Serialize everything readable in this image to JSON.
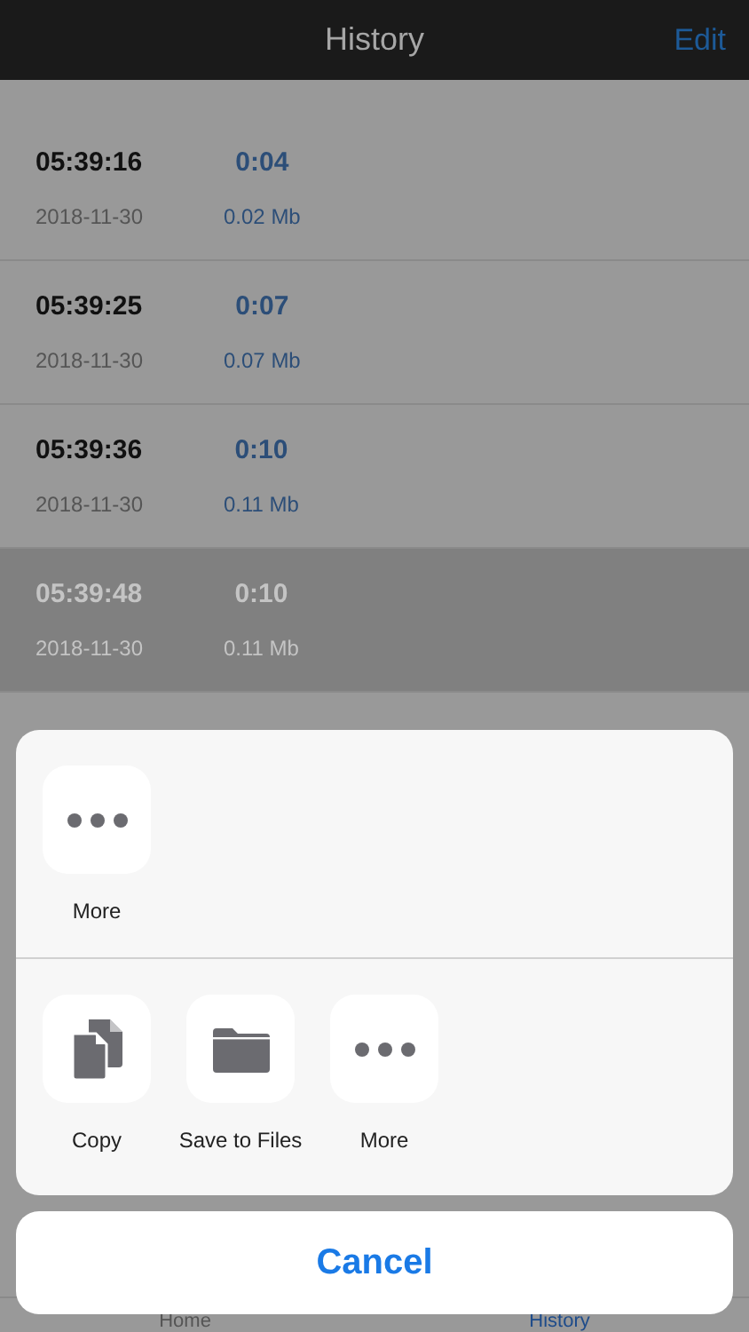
{
  "nav": {
    "title": "History",
    "edit": "Edit"
  },
  "recordings": [
    {
      "time": "05:39:16",
      "date": "2018-11-30",
      "duration": "0:04",
      "size": "0.02 Mb",
      "selected": false
    },
    {
      "time": "05:39:25",
      "date": "2018-11-30",
      "duration": "0:07",
      "size": "0.07 Mb",
      "selected": false
    },
    {
      "time": "05:39:36",
      "date": "2018-11-30",
      "duration": "0:10",
      "size": "0.11 Mb",
      "selected": false
    },
    {
      "time": "05:39:48",
      "date": "2018-11-30",
      "duration": "0:10",
      "size": "0.11 Mb",
      "selected": true
    }
  ],
  "share_sheet": {
    "apps": [
      {
        "kind": "more",
        "label": "More"
      }
    ],
    "actions": [
      {
        "kind": "copy",
        "label": "Copy"
      },
      {
        "kind": "folder",
        "label": "Save to Files"
      },
      {
        "kind": "more",
        "label": "More"
      }
    ],
    "cancel": "Cancel"
  },
  "tab_bar": [
    {
      "label": "Home",
      "selected": false
    },
    {
      "label": "History",
      "selected": true
    }
  ]
}
